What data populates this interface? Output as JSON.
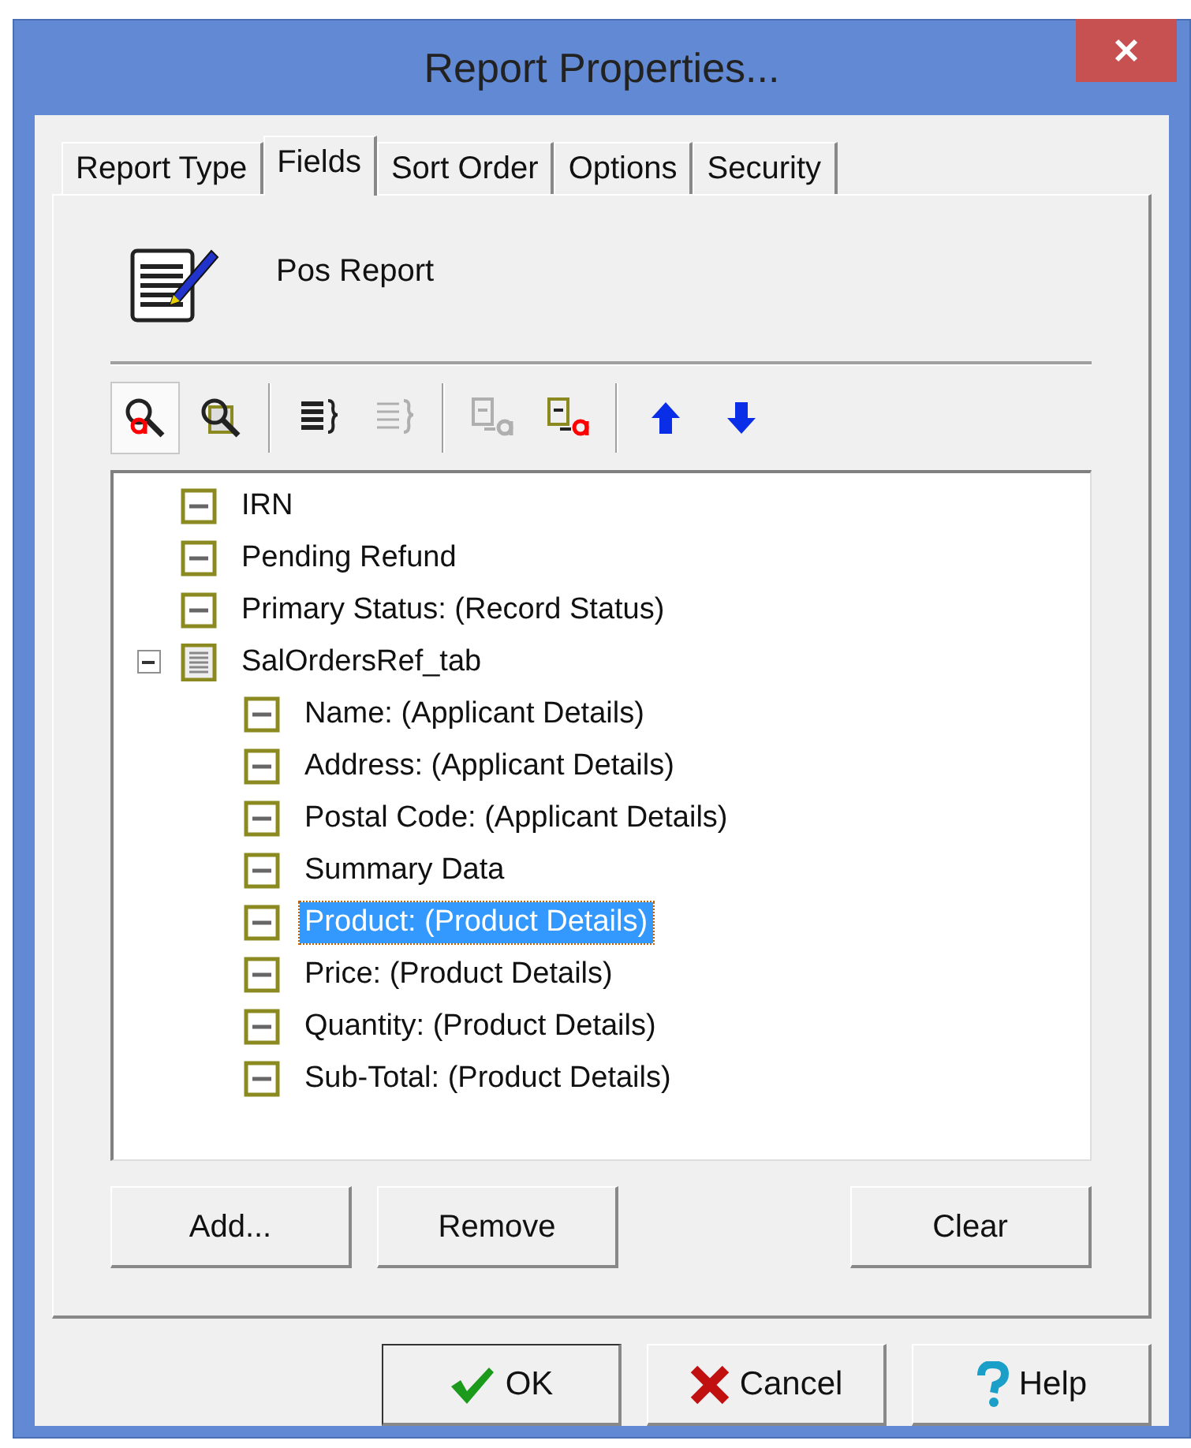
{
  "window": {
    "title": "Report Properties..."
  },
  "tabs": [
    {
      "label": "Report Type",
      "selected": false
    },
    {
      "label": "Fields",
      "selected": true
    },
    {
      "label": "Sort Order",
      "selected": false
    },
    {
      "label": "Options",
      "selected": false
    },
    {
      "label": "Security",
      "selected": false
    }
  ],
  "report": {
    "name": "Pos Report"
  },
  "toolbar": [
    {
      "kind": "find-field",
      "pressed": true,
      "disabled": false
    },
    {
      "kind": "find-table",
      "pressed": false,
      "disabled": false
    },
    {
      "kind": "separator"
    },
    {
      "kind": "expand",
      "pressed": false,
      "disabled": false
    },
    {
      "kind": "collapse",
      "pressed": false,
      "disabled": true
    },
    {
      "kind": "separator"
    },
    {
      "kind": "rename-grey",
      "pressed": false,
      "disabled": true
    },
    {
      "kind": "rename",
      "pressed": false,
      "disabled": false
    },
    {
      "kind": "separator"
    },
    {
      "kind": "up",
      "pressed": false,
      "disabled": false
    },
    {
      "kind": "down",
      "pressed": false,
      "disabled": false
    }
  ],
  "tree": [
    {
      "label": "IRN",
      "kind": "field",
      "selected": false
    },
    {
      "label": "Pending Refund",
      "kind": "field",
      "selected": false
    },
    {
      "label": "Primary Status: (Record Status)",
      "kind": "field",
      "selected": false
    },
    {
      "label": "SalOrdersRef_tab",
      "kind": "table",
      "selected": false,
      "expanded": true,
      "children": [
        {
          "label": "Name: (Applicant Details)",
          "kind": "field",
          "selected": false
        },
        {
          "label": "Address: (Applicant Details)",
          "kind": "field",
          "selected": false
        },
        {
          "label": "Postal Code: (Applicant Details)",
          "kind": "field",
          "selected": false
        },
        {
          "label": "Summary Data",
          "kind": "field",
          "selected": false
        },
        {
          "label": "Product: (Product Details)",
          "kind": "field",
          "selected": true
        },
        {
          "label": "Price: (Product Details)",
          "kind": "field",
          "selected": false
        },
        {
          "label": "Quantity: (Product Details)",
          "kind": "field",
          "selected": false
        },
        {
          "label": "Sub-Total: (Product Details)",
          "kind": "field",
          "selected": false
        }
      ]
    }
  ],
  "field_buttons": [
    "Add...",
    "Remove",
    "Clear"
  ],
  "dialog_buttons": [
    {
      "label": "OK",
      "kind": "ok"
    },
    {
      "label": "Cancel",
      "kind": "cancel"
    },
    {
      "label": "Help",
      "kind": "help"
    }
  ]
}
